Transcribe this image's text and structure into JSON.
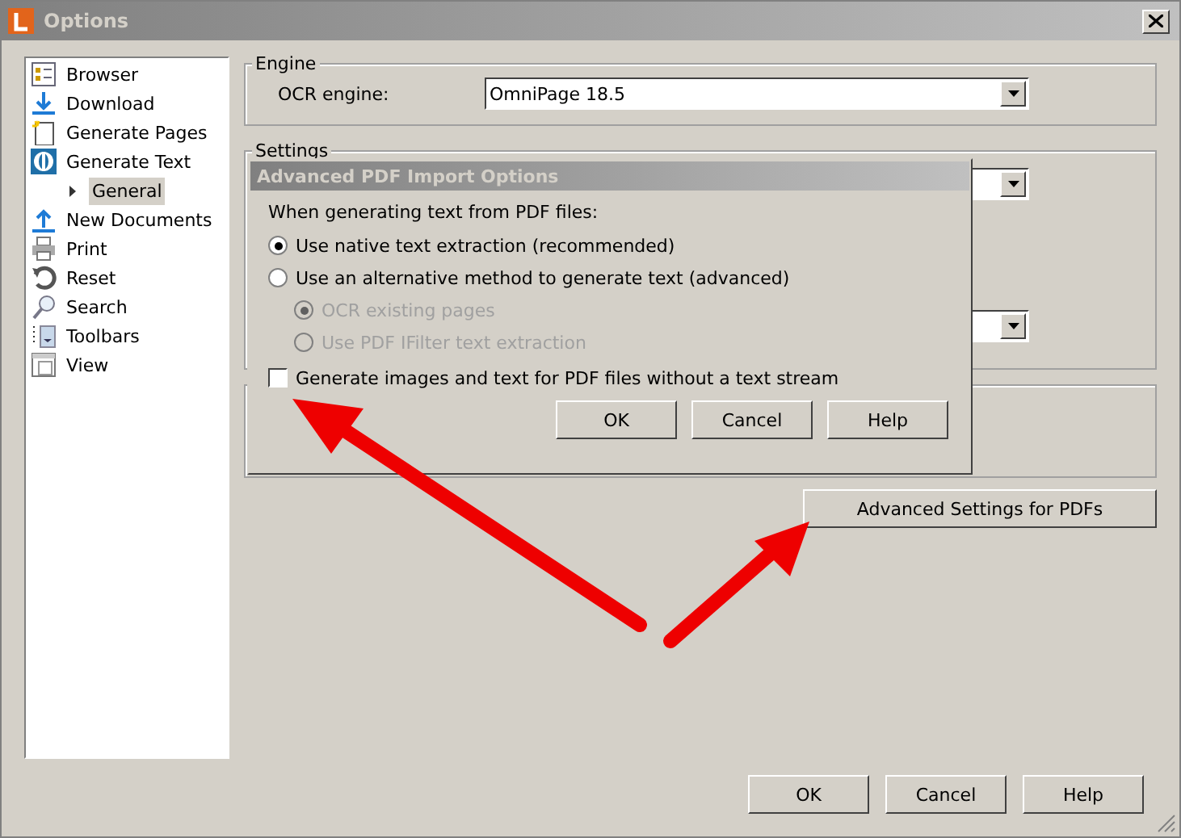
{
  "window": {
    "title": "Options"
  },
  "sidebar": {
    "items": [
      {
        "label": "Browser",
        "selected": false
      },
      {
        "label": "Download",
        "selected": false
      },
      {
        "label": "Generate Pages",
        "selected": false
      },
      {
        "label": "Generate Text",
        "selected": false,
        "expanded": true,
        "children": [
          {
            "label": "General",
            "selected": true
          }
        ]
      },
      {
        "label": "New Documents",
        "selected": false
      },
      {
        "label": "Print",
        "selected": false
      },
      {
        "label": "Reset",
        "selected": false
      },
      {
        "label": "Search",
        "selected": false
      },
      {
        "label": "Toolbars",
        "selected": false
      },
      {
        "label": "View",
        "selected": false
      }
    ]
  },
  "engine_group": {
    "title": "Engine",
    "label": "OCR engine:",
    "value": "OmniPage 18.5"
  },
  "settings_group": {
    "title": "Settings"
  },
  "advanced_button": "Advanced Settings for PDFs",
  "buttons": [
    "OK",
    "Cancel",
    "Help"
  ],
  "dialog": {
    "title": "Advanced PDF Import Options",
    "prompt": "When generating text from PDF files:",
    "options": [
      {
        "label": "Use native text extraction (recommended)",
        "selected": true,
        "disabled": false
      },
      {
        "label": "Use an alternative method to generate text (advanced)",
        "selected": false,
        "disabled": false,
        "children": [
          {
            "label": "OCR existing pages",
            "selected": true,
            "disabled": true
          },
          {
            "label": "Use PDF IFilter text extraction",
            "selected": false,
            "disabled": true
          }
        ]
      }
    ],
    "checkbox": {
      "label": "Generate images and text for PDF files without a text stream",
      "checked": false
    },
    "buttons": [
      "OK",
      "Cancel",
      "Help"
    ]
  }
}
